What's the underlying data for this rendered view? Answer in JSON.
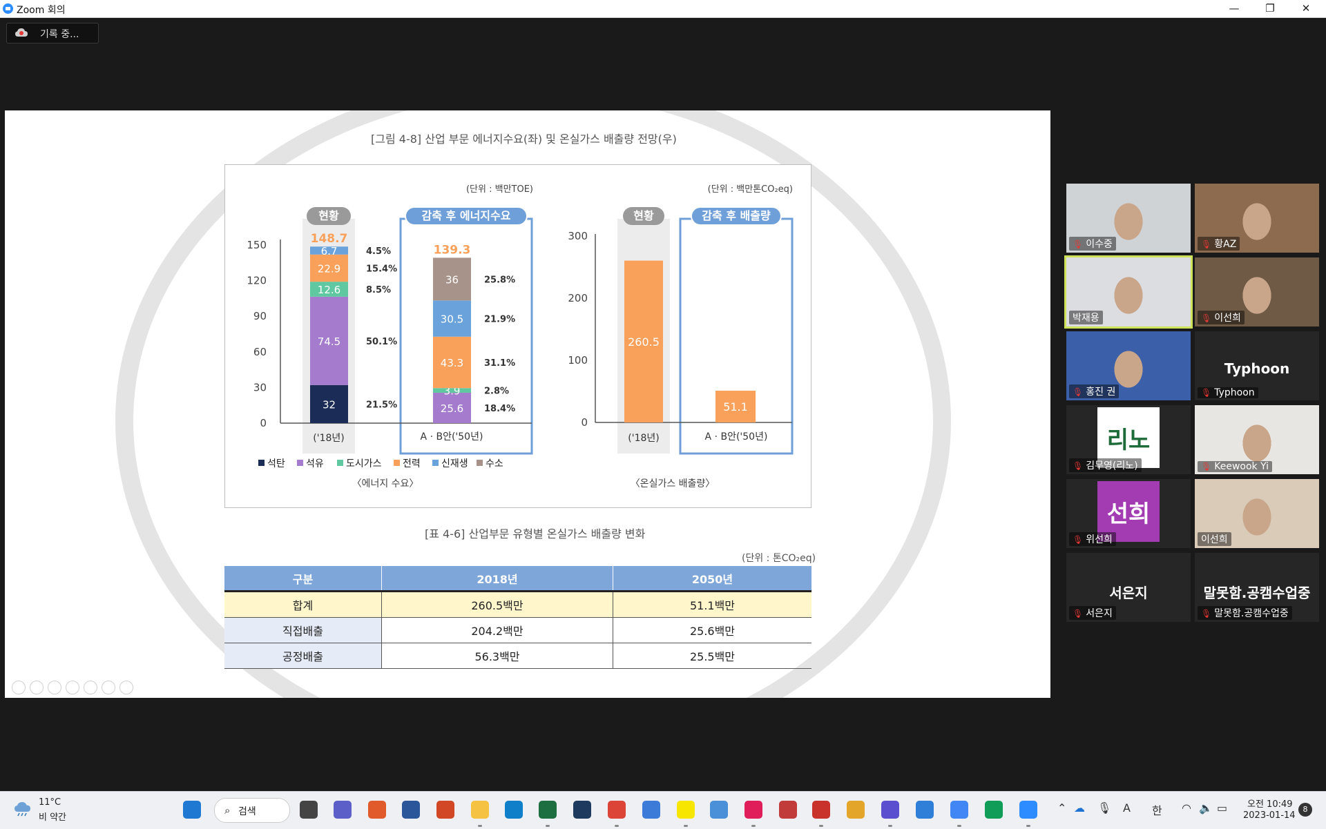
{
  "window": {
    "title": "Zoom 회의",
    "min": "—",
    "restore": "❐",
    "close": "✕"
  },
  "recording": {
    "label": "기록 중..."
  },
  "slide": {
    "figure_caption": "[그림 4-8] 산업 부문 에너지수요(좌) 및 온실가스 배출량 전망(우)",
    "table_caption": "[표 4-6] 산업부문 유형별 온실가스 배출량 변화",
    "table_unit": "(단위 : 톤CO₂eq)",
    "table": {
      "headers": [
        "구분",
        "2018년",
        "2050년"
      ],
      "rows": [
        [
          "합계",
          "260.5백만",
          "51.1백만"
        ],
        [
          "직접배출",
          "204.2백만",
          "25.6백만"
        ],
        [
          "공정배출",
          "56.3백만",
          "25.5백만"
        ]
      ]
    }
  },
  "chart_data": [
    {
      "type": "bar",
      "subtitle": "〈에너지 수요〉",
      "unit": "(단위 : 백만TOE)",
      "categories": [
        "('18년)",
        "A · B안('50년)"
      ],
      "group_labels": [
        "현황",
        "감축 후 에너지수요"
      ],
      "yticks": [
        "150",
        "120",
        "90",
        "60",
        "30",
        "0"
      ],
      "ylim": [
        0,
        150
      ],
      "totals": [
        "148.7",
        "139.3"
      ],
      "legend": [
        {
          "name": "석탄",
          "color": "#1b2d57"
        },
        {
          "name": "석유",
          "color": "#a57ccd"
        },
        {
          "name": "도시가스",
          "color": "#5fc8a0"
        },
        {
          "name": "전력",
          "color": "#f9a15a"
        },
        {
          "name": "신재생",
          "color": "#6aa3dc"
        },
        {
          "name": "수소",
          "color": "#a8938a"
        }
      ],
      "series": [
        {
          "name": "석탄",
          "values": [
            32,
            0
          ],
          "labels": [
            "32",
            ""
          ],
          "shares": [
            "21.5%",
            ""
          ]
        },
        {
          "name": "석유",
          "values": [
            74.5,
            25.6
          ],
          "labels": [
            "74.5",
            "25.6"
          ],
          "shares": [
            "50.1%",
            "18.4%"
          ]
        },
        {
          "name": "도시가스",
          "values": [
            12.6,
            3.9
          ],
          "labels": [
            "12.6",
            "3.9"
          ],
          "shares": [
            "8.5%",
            "2.8%"
          ]
        },
        {
          "name": "전력",
          "values": [
            22.9,
            43.3
          ],
          "labels": [
            "22.9",
            "43.3"
          ],
          "shares": [
            "15.4%",
            "31.1%"
          ]
        },
        {
          "name": "신재생",
          "values": [
            6.7,
            30.5
          ],
          "labels": [
            "6.7",
            "30.5"
          ],
          "shares": [
            "4.5%",
            "21.9%"
          ]
        },
        {
          "name": "수소",
          "values": [
            0,
            36
          ],
          "labels": [
            "",
            "36"
          ],
          "shares": [
            "",
            "25.8%"
          ]
        }
      ]
    },
    {
      "type": "bar",
      "subtitle": "〈온실가스 배출량〉",
      "unit": "(단위 : 백만톤CO₂eq)",
      "categories": [
        "('18년)",
        "A · B안('50년)"
      ],
      "group_labels": [
        "현황",
        "감축 후 배출량"
      ],
      "yticks": [
        "300",
        "200",
        "100",
        "0"
      ],
      "ylim": [
        0,
        300
      ],
      "color": "#f9a15a",
      "values": [
        260.5,
        51.1
      ],
      "labels": [
        "260.5",
        "51.1"
      ]
    }
  ],
  "participants": [
    {
      "name": "이수중",
      "muted": true,
      "video": true,
      "tone": "#cfd3d6"
    },
    {
      "name": "황AZ",
      "muted": true,
      "video": true,
      "tone": "#8c6b4f"
    },
    {
      "name": "박재용",
      "muted": false,
      "video": true,
      "active": true,
      "tone": "#dcdde0"
    },
    {
      "name": "이선희",
      "muted": true,
      "video": true,
      "tone": "#6f5a45"
    },
    {
      "name": "홍진 권",
      "muted": true,
      "video": true,
      "tone": "#3b5fa8"
    },
    {
      "name": "Typhoon",
      "muted": true,
      "video": false,
      "display": "Typhoon"
    },
    {
      "name": "김무영(리노)",
      "muted": true,
      "video": true,
      "tone": "#ffffff",
      "logo": "리노"
    },
    {
      "name": "Keewook Yi",
      "muted": true,
      "video": true,
      "tone": "#e8e6e2"
    },
    {
      "name": "위선희",
      "muted": true,
      "video": true,
      "tone": "#a33bb3",
      "logo": "선희"
    },
    {
      "name": "이선희",
      "muted": false,
      "video": true,
      "tone": "#d9cbb8"
    },
    {
      "name": "서은지",
      "muted": true,
      "video": false,
      "display": "서은지"
    },
    {
      "name": "말못함.공캠수업중",
      "muted": true,
      "video": false,
      "display": "말못함.공캠수업중"
    }
  ],
  "taskbar": {
    "weather_temp": "11°C",
    "weather_desc": "비 약간",
    "search_label": "검색",
    "time": "오전 10:49",
    "date": "2023-01-14",
    "notifications": "8",
    "ime": "한",
    "font_a": "A",
    "apps": [
      {
        "name": "start",
        "color": "#1f78d1"
      },
      {
        "name": "task-view",
        "color": "#444444"
      },
      {
        "name": "teams",
        "color": "#5b5fc7"
      },
      {
        "name": "app-red",
        "color": "#e05a2b"
      },
      {
        "name": "word",
        "color": "#2b579a"
      },
      {
        "name": "powerpoint",
        "color": "#d24726"
      },
      {
        "name": "explorer",
        "color": "#f5c242"
      },
      {
        "name": "edge",
        "color": "#0f7fc9"
      },
      {
        "name": "excel",
        "color": "#1d6f42"
      },
      {
        "name": "terminal",
        "color": "#1e3a5f"
      },
      {
        "name": "chrome",
        "color": "#db4437"
      },
      {
        "name": "settings",
        "color": "#3d7bd8"
      },
      {
        "name": "kakaotalk",
        "color": "#f7e600"
      },
      {
        "name": "notepad",
        "color": "#4a90d9"
      },
      {
        "name": "slack",
        "color": "#e01e5a"
      },
      {
        "name": "calendar",
        "color": "#c23b3b"
      },
      {
        "name": "app-red2",
        "color": "#c8322b"
      },
      {
        "name": "app-yellow",
        "color": "#e4a62a"
      },
      {
        "name": "app-purple",
        "color": "#5a4fcf"
      },
      {
        "name": "photos",
        "color": "#2f7ed8"
      },
      {
        "name": "chrome-2",
        "color": "#4285f4"
      },
      {
        "name": "chrome-3",
        "color": "#0f9d58"
      },
      {
        "name": "zoom",
        "color": "#2d8cff"
      }
    ]
  }
}
